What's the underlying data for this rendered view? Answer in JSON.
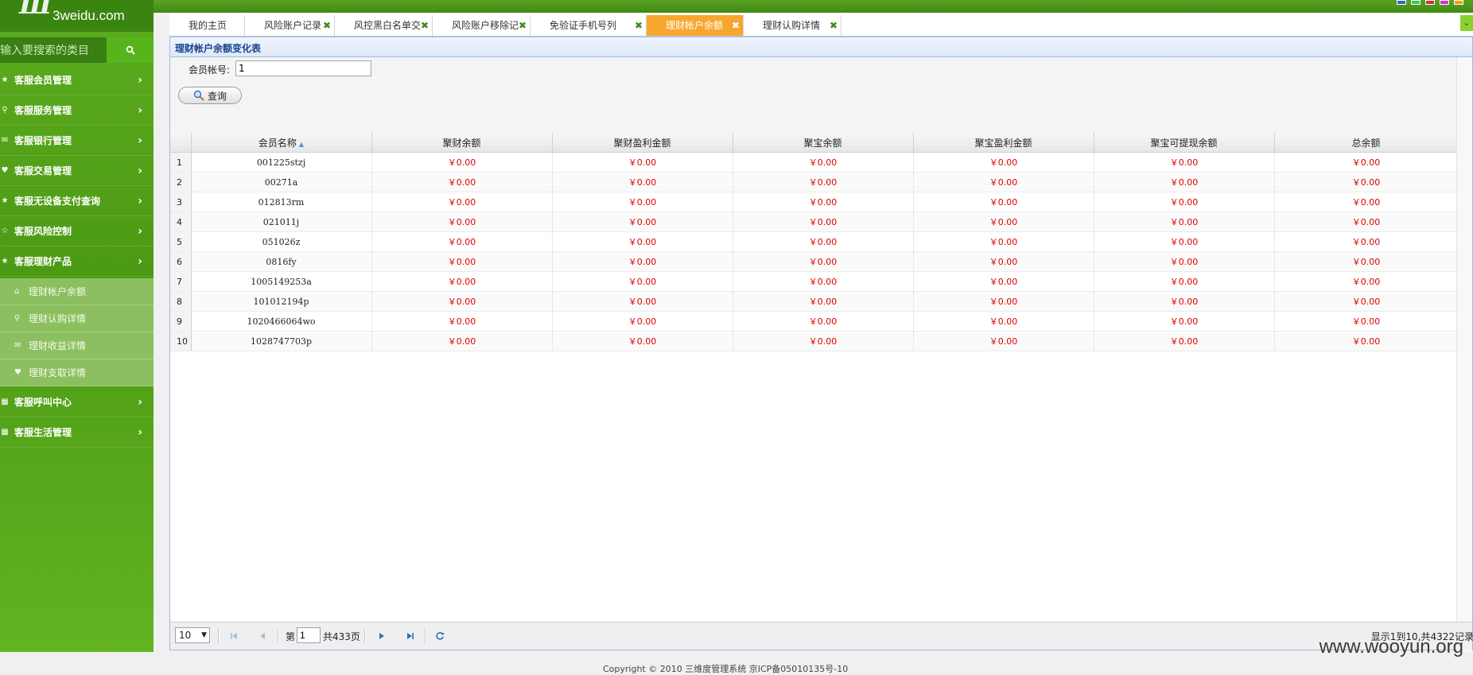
{
  "app": {
    "logo_text": "3weidu.com"
  },
  "colors": {
    "accent_green": "#4c9a14",
    "active_tab": "#f7a630",
    "money_red": "#e00000",
    "swatches": [
      "#3366cc",
      "#33cc66",
      "#cc3333",
      "#cc33cc",
      "#ff9900"
    ]
  },
  "sidebar": {
    "search_placeholder": "输入要搜索的类目",
    "menu": [
      {
        "label": "客服会员管理",
        "icon": "star-icon"
      },
      {
        "label": "客服服务管理",
        "icon": "search-icon"
      },
      {
        "label": "客服银行管理",
        "icon": "envelope-icon"
      },
      {
        "label": "客服交易管理",
        "icon": "heart-icon"
      },
      {
        "label": "客服无设备支付查询",
        "icon": "star-icon"
      },
      {
        "label": "客服风险控制",
        "icon": "star-outline-icon"
      },
      {
        "label": "客服理财产品",
        "icon": "star-icon"
      }
    ],
    "submenu": [
      {
        "label": "理财帐户余额",
        "icon": "home-icon"
      },
      {
        "label": "理财认购详情",
        "icon": "search-icon"
      },
      {
        "label": "理财收益详情",
        "icon": "envelope-icon"
      },
      {
        "label": "理财支取详情",
        "icon": "heart-icon"
      }
    ],
    "menu_after": [
      {
        "label": "客服呼叫中心",
        "icon": "grid-icon"
      },
      {
        "label": "客服生活管理",
        "icon": "grid-icon"
      }
    ]
  },
  "tabs": [
    {
      "label": "我的主页",
      "closable": false
    },
    {
      "label": "风险账户记录",
      "closable": true
    },
    {
      "label": "风控黑白名单交",
      "closable": true
    },
    {
      "label": "风险账户移除记",
      "closable": true
    },
    {
      "label": "免验证手机号列",
      "closable": true
    },
    {
      "label": "理财帐户余额",
      "closable": true,
      "active": true
    },
    {
      "label": "理财认购详情",
      "closable": true
    }
  ],
  "tab_close_glyph": "✖",
  "panel": {
    "title": "理财帐户余额变化表",
    "member_label": "会员帐号:",
    "member_value": "1",
    "query_button": "查询"
  },
  "grid": {
    "columns": [
      "会员名称",
      "聚财余额",
      "聚财盈利金额",
      "聚宝余额",
      "聚宝盈利金额",
      "聚宝可提现余额",
      "总余额"
    ],
    "rows": [
      {
        "n": "1",
        "name": "001225stzj",
        "v": [
          "￥0.00",
          "￥0.00",
          "￥0.00",
          "￥0.00",
          "￥0.00",
          "￥0.00"
        ]
      },
      {
        "n": "2",
        "name": "00271a",
        "v": [
          "￥0.00",
          "￥0.00",
          "￥0.00",
          "￥0.00",
          "￥0.00",
          "￥0.00"
        ]
      },
      {
        "n": "3",
        "name": "012813rm",
        "v": [
          "￥0.00",
          "￥0.00",
          "￥0.00",
          "￥0.00",
          "￥0.00",
          "￥0.00"
        ]
      },
      {
        "n": "4",
        "name": "021011j",
        "v": [
          "￥0.00",
          "￥0.00",
          "￥0.00",
          "￥0.00",
          "￥0.00",
          "￥0.00"
        ]
      },
      {
        "n": "5",
        "name": "051026z",
        "v": [
          "￥0.00",
          "￥0.00",
          "￥0.00",
          "￥0.00",
          "￥0.00",
          "￥0.00"
        ]
      },
      {
        "n": "6",
        "name": "0816fy",
        "v": [
          "￥0.00",
          "￥0.00",
          "￥0.00",
          "￥0.00",
          "￥0.00",
          "￥0.00"
        ]
      },
      {
        "n": "7",
        "name": "1005149253a",
        "v": [
          "￥0.00",
          "￥0.00",
          "￥0.00",
          "￥0.00",
          "￥0.00",
          "￥0.00"
        ]
      },
      {
        "n": "8",
        "name": "101012194p",
        "v": [
          "￥0.00",
          "￥0.00",
          "￥0.00",
          "￥0.00",
          "￥0.00",
          "￥0.00"
        ]
      },
      {
        "n": "9",
        "name": "1020466064wo",
        "v": [
          "￥0.00",
          "￥0.00",
          "￥0.00",
          "￥0.00",
          "￥0.00",
          "￥0.00"
        ]
      },
      {
        "n": "10",
        "name": "1028747703p",
        "v": [
          "￥0.00",
          "￥0.00",
          "￥0.00",
          "￥0.00",
          "￥0.00",
          "￥0.00"
        ]
      }
    ]
  },
  "pager": {
    "page_size": "10",
    "page_prefix": "第",
    "page_number": "1",
    "page_total": "共433页",
    "record_info": "显示1到10,共4322记录"
  },
  "footer": {
    "copyright": "Copyright © 2010 三维度管理系统 京ICP备05010135号-10"
  },
  "watermark": "www.wooyun.org"
}
